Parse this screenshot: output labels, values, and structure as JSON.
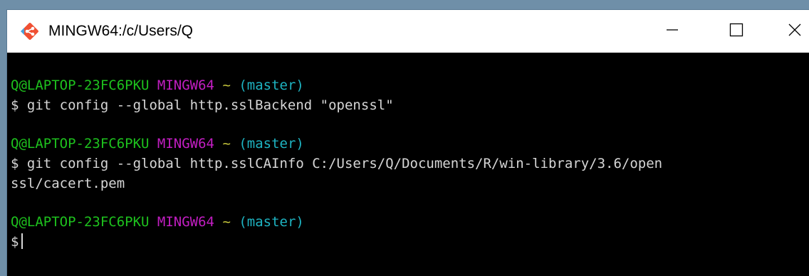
{
  "window": {
    "title": "MINGW64:/c/Users/Q",
    "icon": "git-icon",
    "controls": {
      "minimize": "minimize-icon",
      "maximize": "maximize-icon",
      "close": "close-icon"
    }
  },
  "colors": {
    "user_host": "#1ec21e",
    "system": "#c21ec2",
    "tilde": "#c8c83c",
    "branch": "#1eb4c2",
    "text": "#d6d6d6",
    "background": "#000000"
  },
  "terminal": {
    "blocks": [
      {
        "user_host": "Q@LAPTOP-23FC6PKU",
        "system": "MINGW64",
        "path": "~",
        "branch": "(master)",
        "command_lines": [
          "$ git config --global http.sslBackend \"openssl\""
        ]
      },
      {
        "user_host": "Q@LAPTOP-23FC6PKU",
        "system": "MINGW64",
        "path": "~",
        "branch": "(master)",
        "command_lines": [
          "$ git config --global http.sslCAInfo C:/Users/Q/Documents/R/win-library/3.6/open",
          "ssl/cacert.pem"
        ]
      },
      {
        "user_host": "Q@LAPTOP-23FC6PKU",
        "system": "MINGW64",
        "path": "~",
        "branch": "(master)",
        "command_lines": [
          "$"
        ]
      }
    ]
  }
}
